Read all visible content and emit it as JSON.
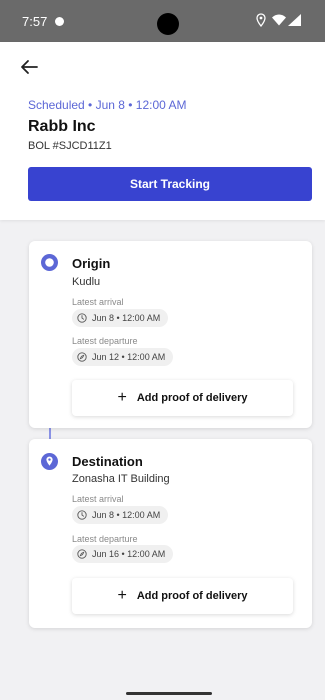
{
  "status_bar": {
    "time": "7:57"
  },
  "header": {
    "scheduled_text": "Scheduled • Jun 8 • 12:00 AM",
    "company": "Rabb Inc",
    "bol": "BOL #SJCD11Z1",
    "start_tracking_label": "Start Tracking"
  },
  "stops": [
    {
      "title": "Origin",
      "location": "Kudlu",
      "arrival_label": "Latest arrival",
      "arrival_value": "Jun 8 • 12:00 AM",
      "departure_label": "Latest departure",
      "departure_value": "Jun 12 • 12:00 AM",
      "proof_label": "Add proof of delivery",
      "marker_icon": "origin-circle-icon"
    },
    {
      "title": "Destination",
      "location": "Zonasha IT Building",
      "arrival_label": "Latest arrival",
      "arrival_value": "Jun 8 • 12:00 AM",
      "departure_label": "Latest departure",
      "departure_value": "Jun 16 • 12:00 AM",
      "proof_label": "Add proof of delivery",
      "marker_icon": "destination-pin-icon"
    }
  ],
  "colors": {
    "accent": "#3843d0",
    "accent_text": "#5c67d6",
    "timeline": "#8a92e6",
    "background": "#f1f1f3"
  }
}
